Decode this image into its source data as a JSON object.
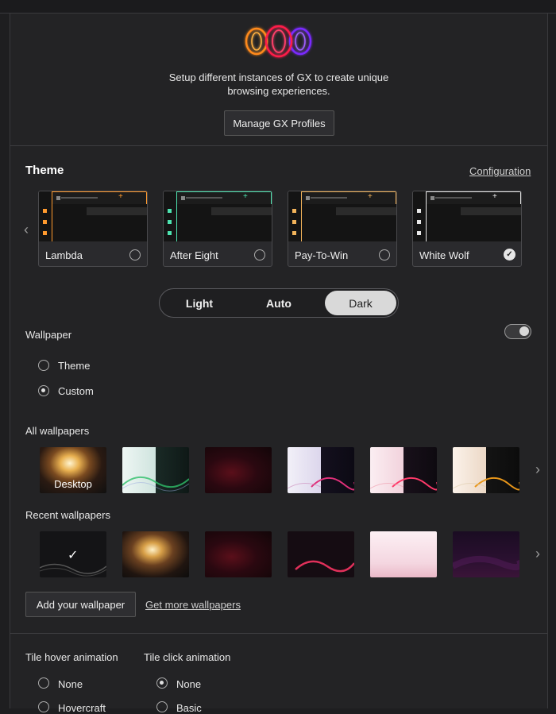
{
  "profiles": {
    "text_line1": "Setup different instances of GX to create unique",
    "text_line2": "browsing experiences.",
    "manage_button": "Manage GX Profiles"
  },
  "theme": {
    "title": "Theme",
    "configuration_link": "Configuration",
    "cards": [
      {
        "label": "Lambda",
        "accent": "#ff9a2e",
        "selected": false
      },
      {
        "label": "After Eight",
        "accent": "#4de3b0",
        "selected": false
      },
      {
        "label": "Pay-To-Win",
        "accent": "#f2b35a",
        "selected": false
      },
      {
        "label": "White Wolf",
        "accent": "#e8e8e8",
        "selected": true
      }
    ],
    "modes": {
      "light": "Light",
      "auto": "Auto",
      "dark": "Dark",
      "selected": "Dark"
    }
  },
  "wallpaper": {
    "title": "Wallpaper",
    "enabled": true,
    "options": {
      "theme": "Theme",
      "custom": "Custom",
      "selected": "Custom"
    },
    "all_title": "All wallpapers",
    "desktop_label": "Desktop",
    "recent_title": "Recent wallpapers",
    "add_button": "Add your wallpaper",
    "get_more_link": "Get more wallpapers"
  },
  "animations": {
    "hover_title": "Tile hover animation",
    "click_title": "Tile click animation",
    "hover_options": [
      "None",
      "Hovercraft"
    ],
    "click_options": [
      "None",
      "Basic"
    ],
    "hover_selected": "",
    "click_selected": "None"
  },
  "icons": {
    "logo": "gx-profiles-logo",
    "left_arrow": "chevron-left-icon",
    "right_arrow": "chevron-right-icon",
    "check": "check-icon"
  }
}
